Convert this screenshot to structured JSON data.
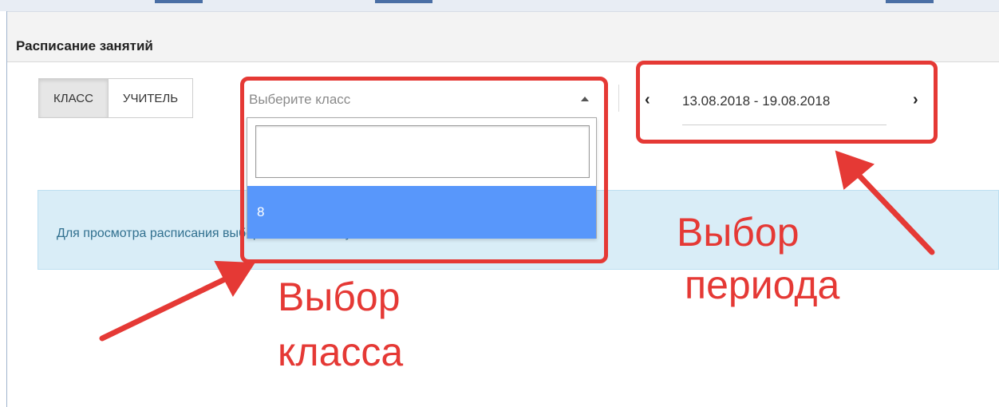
{
  "header": {
    "title": "Расписание занятий"
  },
  "toggle": {
    "class_label": "КЛАСС",
    "teacher_label": "УЧИТЕЛЬ",
    "active": "class"
  },
  "class_select": {
    "placeholder": "Выберите класс",
    "search_value": "",
    "options": [
      "8"
    ],
    "highlighted_option": "8"
  },
  "period": {
    "range": "13.08.2018 - 19.08.2018",
    "prev_glyph": "‹",
    "next_glyph": "›"
  },
  "info": {
    "text": "Для просмотра расписания выберите класс или учителя"
  },
  "annotations": {
    "class_pick_line1": "Выбор",
    "class_pick_line2": "класса",
    "period_pick_line1": "Выбор",
    "period_pick_line2": "периода",
    "color": "#e53935"
  }
}
